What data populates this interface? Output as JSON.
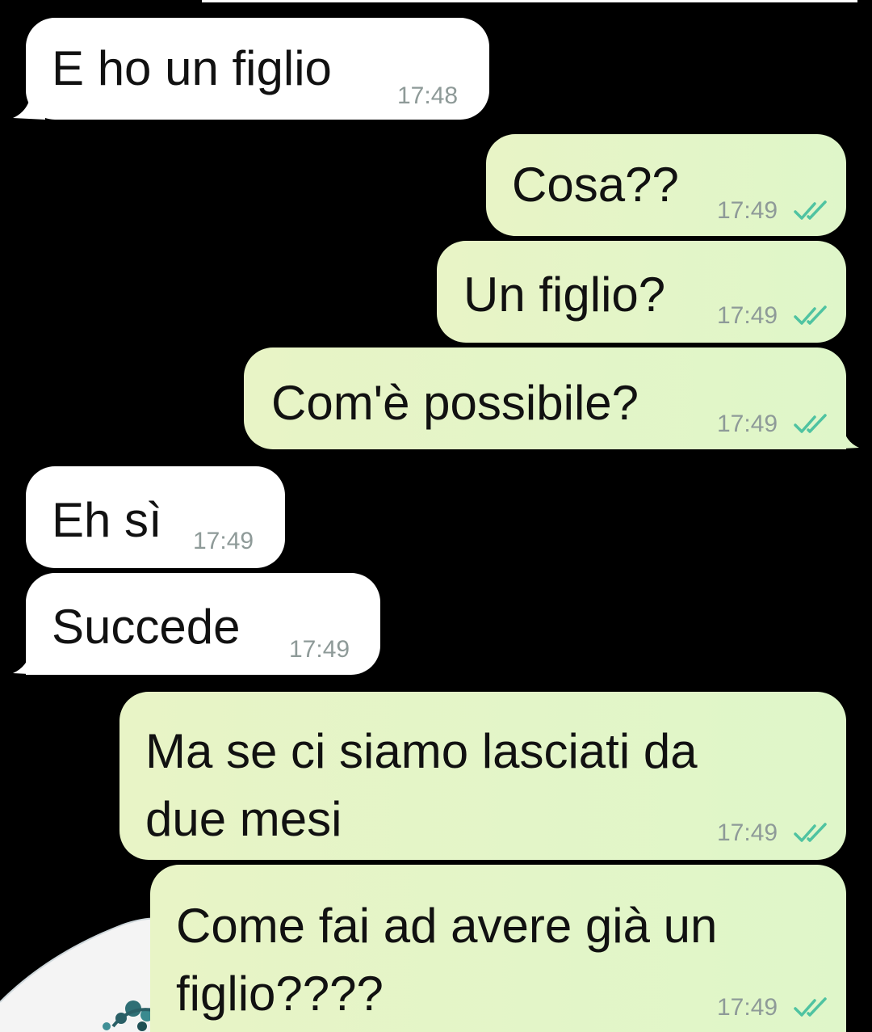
{
  "messages": [
    {
      "text": "E ho un figlio",
      "time": "17:48"
    },
    {
      "text": "Cosa??",
      "time": "17:49",
      "status_icon": "double-check-icon"
    },
    {
      "text": "Un figlio?",
      "time": "17:49",
      "status_icon": "double-check-icon"
    },
    {
      "text": "Com'è possibile?",
      "time": "17:49",
      "status_icon": "double-check-icon"
    },
    {
      "text": "Eh sì",
      "time": "17:49"
    },
    {
      "text": "Succede",
      "time": "17:49"
    },
    {
      "text": "Ma se ci siamo lasciati da\ndue mesi",
      "time": "17:49",
      "status_icon": "double-check-icon"
    },
    {
      "text": "Come fai ad avere già un\nfiglio????",
      "time": "17:49",
      "status_icon": "double-check-icon"
    }
  ],
  "colors": {
    "background": "#000000",
    "incoming_bubble": "#ffffff",
    "outgoing_bubble": "#e2f5c8",
    "timestamp": "#8e9a98",
    "read_ticks": "#4fc3a1"
  }
}
